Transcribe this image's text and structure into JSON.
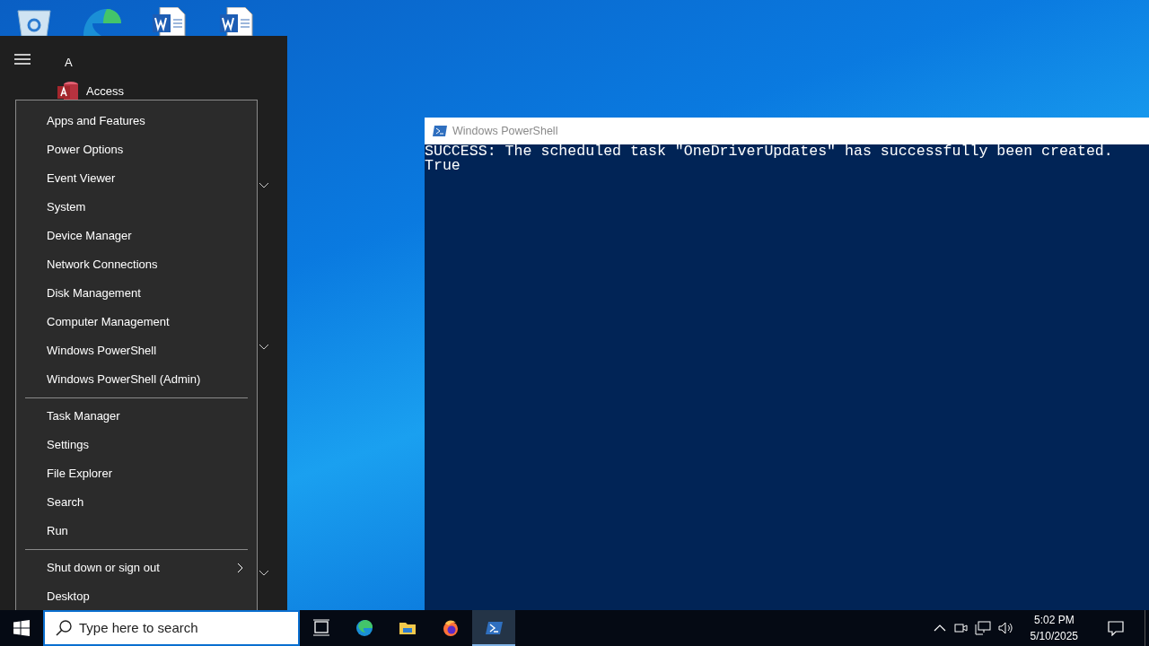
{
  "desktop_icons": [
    {
      "kind": "recycle-bin"
    },
    {
      "kind": "edge"
    },
    {
      "kind": "word"
    },
    {
      "kind": "word"
    }
  ],
  "start_menu": {
    "group_letter": "A",
    "apps": [
      {
        "name": "Access",
        "kind": "access"
      }
    ]
  },
  "context_menu": {
    "items": [
      {
        "kind": "item",
        "label": "Apps and Features"
      },
      {
        "kind": "item",
        "label": "Power Options"
      },
      {
        "kind": "item",
        "label": "Event Viewer"
      },
      {
        "kind": "item",
        "label": "System"
      },
      {
        "kind": "item",
        "label": "Device Manager"
      },
      {
        "kind": "item",
        "label": "Network Connections"
      },
      {
        "kind": "item",
        "label": "Disk Management"
      },
      {
        "kind": "item",
        "label": "Computer Management"
      },
      {
        "kind": "item",
        "label": "Windows PowerShell"
      },
      {
        "kind": "item",
        "label": "Windows PowerShell (Admin)"
      },
      {
        "kind": "separator"
      },
      {
        "kind": "item",
        "label": "Task Manager"
      },
      {
        "kind": "item",
        "label": "Settings"
      },
      {
        "kind": "item",
        "label": "File Explorer"
      },
      {
        "kind": "item",
        "label": "Search"
      },
      {
        "kind": "item",
        "label": "Run"
      },
      {
        "kind": "separator"
      },
      {
        "kind": "submenu",
        "label": "Shut down or sign out"
      },
      {
        "kind": "item",
        "label": "Desktop"
      }
    ]
  },
  "powershell": {
    "title": "Windows PowerShell",
    "lines": [
      "SUCCESS: The scheduled task \"OneDriverUpdates\" has successfully been created.",
      "True"
    ]
  },
  "taskbar": {
    "search_placeholder": "Type here to search",
    "apps": [
      {
        "kind": "task-view",
        "selected": false
      },
      {
        "kind": "edge",
        "selected": false
      },
      {
        "kind": "explorer",
        "selected": false
      },
      {
        "kind": "firefox",
        "selected": false
      },
      {
        "kind": "powershell",
        "selected": true
      }
    ],
    "time": "5:02 PM",
    "date": "5/10/2025"
  }
}
